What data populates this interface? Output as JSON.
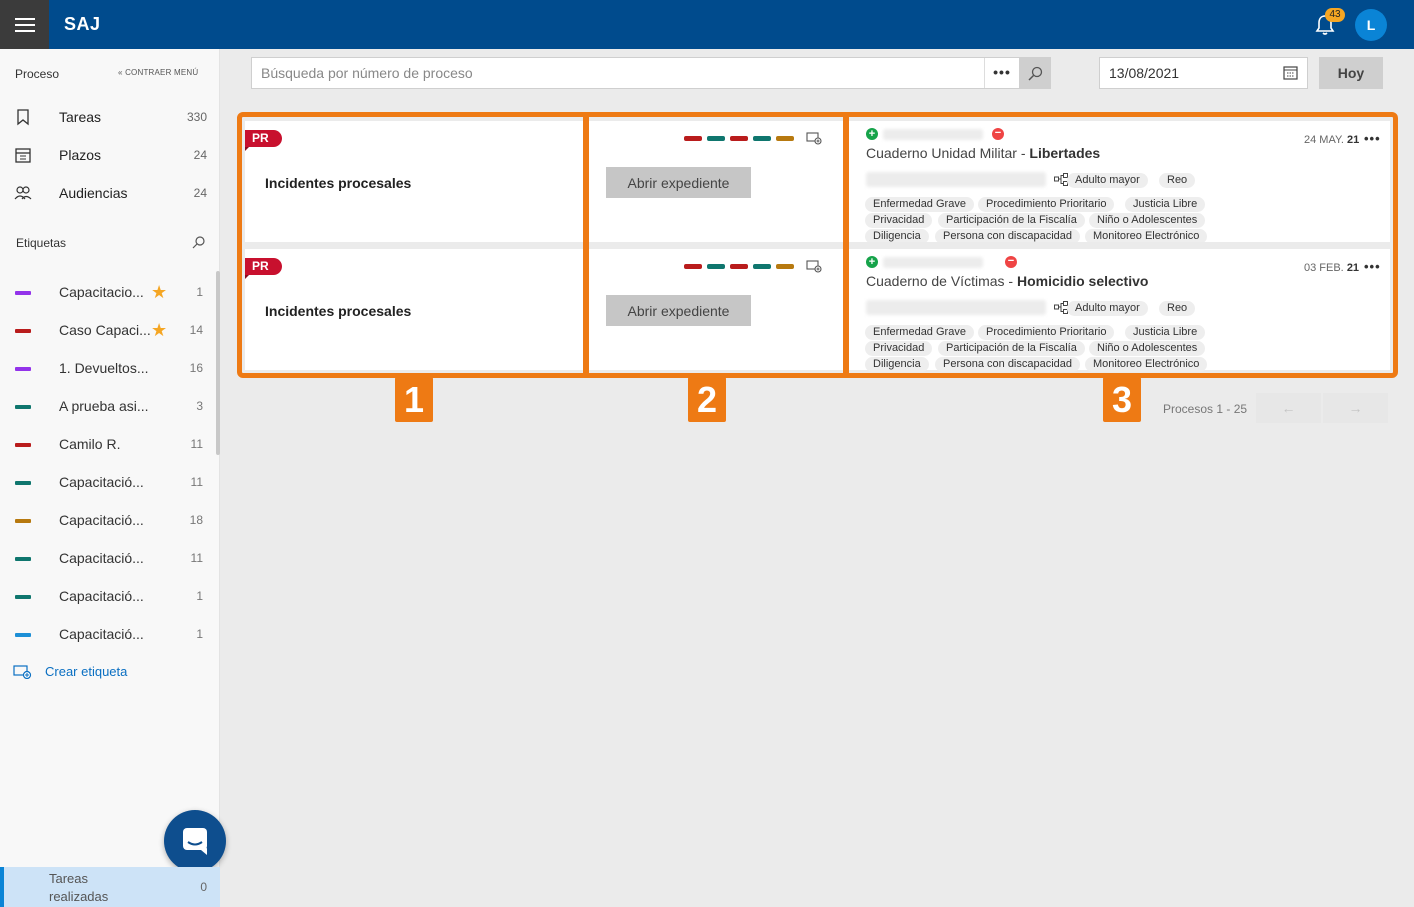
{
  "header": {
    "brand": "SAJ",
    "notifications": "43",
    "avatar": "L"
  },
  "sidebar": {
    "section": "Proceso",
    "collapse": "« CONTRAER MENÚ",
    "nav": [
      {
        "label": "Tareas",
        "count": "330"
      },
      {
        "label": "Plazos",
        "count": "24"
      },
      {
        "label": "Audiencias",
        "count": "24"
      }
    ],
    "tags_title": "Etiquetas",
    "tags": [
      {
        "label": "Capacitacio...",
        "count": "1",
        "color": "#9333ea",
        "starred": true
      },
      {
        "label": "Caso Capaci...",
        "count": "14",
        "color": "#b91c1c",
        "starred": true
      },
      {
        "label": "1. Devueltos...",
        "count": "16",
        "color": "#9333ea",
        "starred": false
      },
      {
        "label": "A prueba asi...",
        "count": "3",
        "color": "#0f766e",
        "starred": false
      },
      {
        "label": "Camilo R.",
        "count": "11",
        "color": "#b91c1c",
        "starred": false
      },
      {
        "label": "Capacitació...",
        "count": "11",
        "color": "#0f766e",
        "starred": false
      },
      {
        "label": "Capacitació...",
        "count": "18",
        "color": "#b7790f",
        "starred": false
      },
      {
        "label": "Capacitació...",
        "count": "11",
        "color": "#0f766e",
        "starred": false
      },
      {
        "label": "Capacitació...",
        "count": "1",
        "color": "#0f766e",
        "starred": false
      },
      {
        "label": "Capacitació...",
        "count": "1",
        "color": "#1d8fd6",
        "starred": false
      }
    ],
    "create_tag": "Crear etiqueta",
    "done": {
      "label": "Tareas realizadas",
      "count": "0"
    }
  },
  "toolbar": {
    "search_placeholder": "Búsqueda por número de proceso",
    "more": "•••",
    "date": "13/08/2021",
    "today": "Hoy"
  },
  "rows": [
    {
      "badge": "PR",
      "title": "Incidentes procesales",
      "open_label": "Abrir expediente",
      "swatches": [
        "#b91c1c",
        "#0f766e",
        "#b91c1c",
        "#0f766e",
        "#b7790f"
      ],
      "card_title_plain": "Cuaderno Unidad Militar - ",
      "card_title_bold": "Libertades",
      "date_plain": "24 MAY.",
      "date_bold": "21",
      "chips": [
        "Adulto mayor",
        "Reo",
        "Enfermedad Grave",
        "Procedimiento Prioritario",
        "Justicia Libre",
        "Privacidad",
        "Participación de la Fiscalía",
        "Niño o Adolescentes",
        "Diligencia",
        "Persona con discapacidad",
        "Monitoreo Electrónico"
      ]
    },
    {
      "badge": "PR",
      "title": "Incidentes procesales",
      "open_label": "Abrir expediente",
      "swatches": [
        "#b91c1c",
        "#0f766e",
        "#b91c1c",
        "#0f766e",
        "#b7790f"
      ],
      "card_title_plain": "Cuaderno de Víctimas - ",
      "card_title_bold": "Homicidio selectivo",
      "date_plain": "03 FEB.",
      "date_bold": "21",
      "chips": [
        "Adulto mayor",
        "Reo",
        "Enfermedad Grave",
        "Procedimiento Prioritario",
        "Justicia Libre",
        "Privacidad",
        "Participación de la Fiscalía",
        "Niño o Adolescentes",
        "Diligencia",
        "Persona con discapacidad",
        "Monitoreo Electrónico"
      ]
    }
  ],
  "steps": [
    "1",
    "2",
    "3"
  ],
  "paging": {
    "label": "Procesos 1 - 25",
    "prev": "←",
    "next": "→"
  },
  "colors": {
    "header": "#004b8d",
    "highlight": "#ee7a14",
    "badge": "#c8102e"
  }
}
